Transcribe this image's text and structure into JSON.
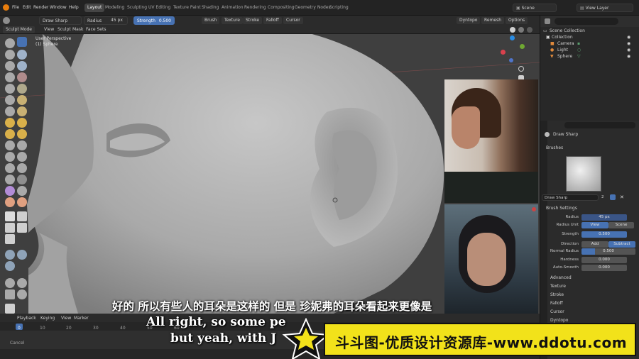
{
  "top_menu": [
    "File",
    "Edit",
    "Render",
    "Window",
    "Help"
  ],
  "workspaces": [
    "Layout",
    "Modeling",
    "Sculpting",
    "UV Editing",
    "Texture Paint",
    "Shading",
    "Animation",
    "Rendering",
    "Compositing",
    "Geometry Nodes",
    "Scripting"
  ],
  "active_workspace": "Layout",
  "scene": "Scene",
  "view_layer": "View Layer",
  "tool_header": {
    "brush_name": "Draw Sharp",
    "radius_label": "Radius",
    "radius_value": "45 px",
    "strength_label": "Strength",
    "strength_value": "0.500",
    "brush_dd": "Brush",
    "texture_dd": "Texture",
    "stroke_dd": "Stroke",
    "falloff_dd": "Falloff",
    "cursor_dd": "Cursor",
    "dyntopo": "Dyntopo",
    "remesh": "Remesh",
    "options": "Options"
  },
  "mode_header": {
    "mode": "Sculpt Mode",
    "menus": [
      "View",
      "Sculpt",
      "Mask",
      "Face Sets"
    ]
  },
  "viewport": {
    "perspective": "User Perspective",
    "object": "(1) Sphere"
  },
  "outliner": {
    "root": "Scene Collection",
    "collection": "Collection",
    "items": [
      "Camera",
      "Light",
      "Sphere"
    ]
  },
  "properties": {
    "brush_title": "Draw Sharp",
    "brushes_section": "Brushes",
    "brush_field": "Draw Sharp",
    "brush_users": "2",
    "brush_settings": "Brush Settings",
    "rows": [
      {
        "label": "Radius",
        "value": "45 px"
      },
      {
        "label": "Radius Unit",
        "value": "View",
        "value2": "Scene"
      },
      {
        "label": "Strength",
        "value": "0.500"
      },
      {
        "label": "Direction",
        "value": "Add",
        "value2": "Subtract"
      },
      {
        "label": "Normal Radius",
        "value": "0.500"
      },
      {
        "label": "Hardness",
        "value": "0.000"
      },
      {
        "label": "Auto-Smooth",
        "value": "0.000"
      }
    ],
    "sections": [
      "Advanced",
      "Texture",
      "Stroke",
      "Falloff",
      "Cursor",
      "Dyntopo"
    ]
  },
  "timeline": {
    "menus": [
      "Playback",
      "Keying",
      "View",
      "Marker"
    ],
    "ticks": [
      "0",
      "10",
      "20",
      "30",
      "40",
      "50",
      "60"
    ],
    "status": "Cancel"
  },
  "subtitles": {
    "chinese": "好的 所以有些人的耳朵是这样的 但是 珍妮弗的耳朵看起来更像是",
    "english_1": "All right, so some pe",
    "english_2": "but yeah, with J"
  },
  "watermark": "斗斗图-优质设计资源库-www.ddotu.com"
}
